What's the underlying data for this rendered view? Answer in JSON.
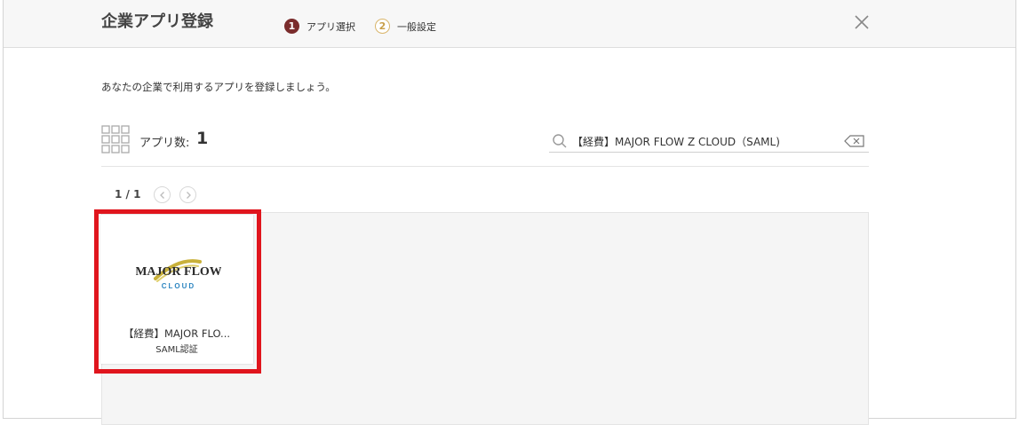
{
  "modal": {
    "title": "企業アプリ登録"
  },
  "steps": [
    {
      "num": "1",
      "label": "アプリ選択"
    },
    {
      "num": "2",
      "label": "一般設定"
    }
  ],
  "intro": "あなたの企業で利用するアプリを登録しましょう。",
  "app_count": {
    "label": "アプリ数:",
    "value": "1"
  },
  "search": {
    "value": "【経費】MAJOR FLOW Z CLOUD（SAML)"
  },
  "pager": {
    "text": "1 / 1"
  },
  "cards": [
    {
      "title": "【経費】MAJOR FLO...",
      "subtitle": "SAML認証",
      "logo": {
        "main": "MAJOR FLOW",
        "sub": "CLOUD"
      }
    }
  ],
  "colors": {
    "accent": "#7a2c2c",
    "step_inactive": "#d9b56a",
    "highlight": "#e0151d",
    "logo_gold": "#c9b13a",
    "logo_blue": "#2e86c1"
  }
}
